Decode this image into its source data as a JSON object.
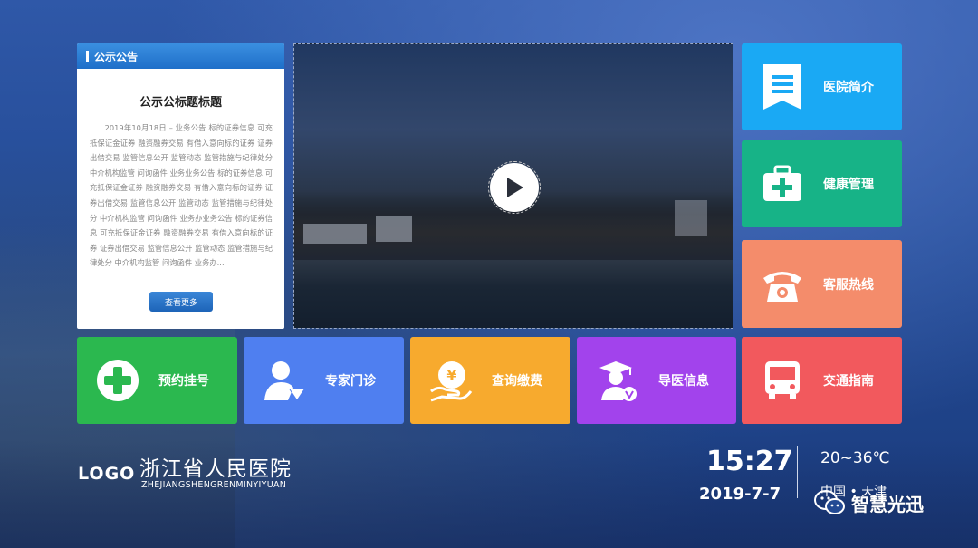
{
  "notice": {
    "header": "公示公告",
    "title": "公示公标题标题",
    "body": "2019年10月18日 – 业务公告 标的证券信息 可充抵保证金证券 融资融券交易 有借入意向标的证券 证券出借交易 监管信息公开 监管动态 监管措施与纪律处分 中介机构监管 问询函件 业务业务公告 标的证券信息 可充抵保证金证券 融资融券交易 有借入意向标的证券 证券出借交易 监管信息公开 监管动态 监管措施与纪律处分 中介机构监管 问询函件 业务办业务公告 标的证券信息 可充抵保证金证券 融资融券交易 有借入意向标的证券 证券出借交易 监管信息公开 监管动态 监管措施与纪律处分 中介机构监管 问询函件 业务办...",
    "more_label": "查看更多"
  },
  "tiles": {
    "intro": {
      "label": "医院简介",
      "color": "#1aa9f4",
      "icon": "bookmark-list-icon"
    },
    "health": {
      "label": "健康管理",
      "color": "#17b387",
      "icon": "medical-kit-icon"
    },
    "hotline": {
      "label": "客服热线",
      "color": "#f48c6b",
      "icon": "telephone-icon"
    },
    "traffic": {
      "label": "交通指南",
      "color": "#f2595d",
      "icon": "bus-icon"
    },
    "register": {
      "label": "预约挂号",
      "color": "#2bb84f",
      "icon": "medical-cross-icon"
    },
    "expert": {
      "label": "专家门诊",
      "color": "#4f7ff0",
      "icon": "expert-doctor-icon"
    },
    "payment": {
      "label": "查询缴费",
      "color": "#f7aa2e",
      "icon": "yuan-payment-icon"
    },
    "guide": {
      "label": "导医信息",
      "color": "#a243ec",
      "icon": "graduate-guide-icon"
    }
  },
  "video": {
    "icon": "play-icon"
  },
  "footer": {
    "logo": "LOGO",
    "hospital_name": "浙江省人民医院",
    "hospital_pinyin": "ZHEJIANGSHENGRENMINYIYUAN",
    "time": "15:27",
    "date": "2019-7-7",
    "temperature": "20~36℃",
    "location": "中国 • 天津"
  },
  "watermark": {
    "text": "智慧光迅",
    "icon": "wechat-icon"
  }
}
